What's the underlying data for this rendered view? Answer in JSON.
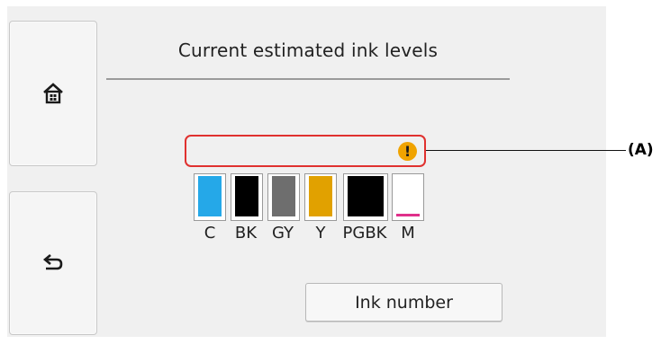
{
  "screen": {
    "title": "Current estimated ink levels",
    "callout_label": "(A)"
  },
  "buttons": {
    "home_icon": "home-icon",
    "back_icon": "back-arrow-icon",
    "ink_number_label": "Ink number"
  },
  "alert": {
    "icon": "exclamation-icon",
    "icon_text": "!",
    "icon_color": "#f0a300",
    "frame_color": "#e0312f"
  },
  "inks": [
    {
      "label": "C",
      "color": "#25a8e8",
      "level": 1.0
    },
    {
      "label": "BK",
      "color": "#000000",
      "level": 1.0
    },
    {
      "label": "GY",
      "color": "#6e6e6e",
      "level": 1.0
    },
    {
      "label": "Y",
      "color": "#e1a100",
      "level": 1.0
    },
    {
      "label": "PGBK",
      "color": "#000000",
      "level": 1.0
    },
    {
      "label": "M",
      "color": "#e0308a",
      "level": 0.05
    }
  ]
}
